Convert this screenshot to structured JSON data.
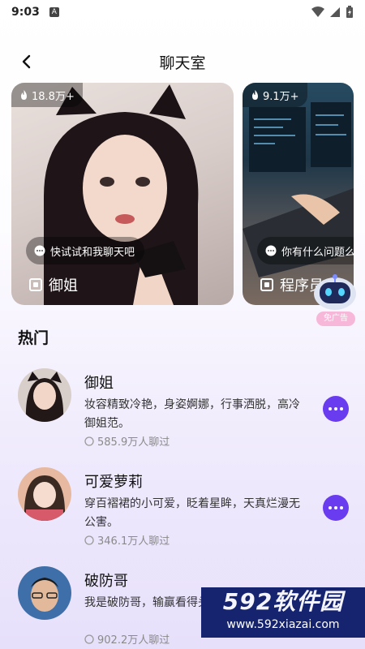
{
  "status": {
    "time": "9:03",
    "notification": "A"
  },
  "header": {
    "title": "聊天室"
  },
  "cards": [
    {
      "heat": "18.8万+",
      "bubble": "快试试和我聊天吧",
      "label": "御姐"
    },
    {
      "heat": "9.1万+",
      "bubble": "你有什么问题么",
      "label": "程序员"
    }
  ],
  "robot": {
    "tag": "免广告"
  },
  "section": {
    "title": "热门"
  },
  "items": [
    {
      "name": "御姐",
      "desc": "妆容精致冷艳，身姿婀娜，行事洒脱，高冷御姐范。",
      "meta": "585.9万人聊过"
    },
    {
      "name": "可爱萝莉",
      "desc": "穿百褶裙的小可爱，眨着星眸，天真烂漫无公害。",
      "meta": "346.1万人聊过"
    },
    {
      "name": "破防哥",
      "desc": "我是破防哥，输赢看得头别轻易惹我。",
      "meta": "902.2万人聊过"
    }
  ],
  "watermark": {
    "top": "592软件园",
    "bottom": "www.592xiazai.com"
  }
}
